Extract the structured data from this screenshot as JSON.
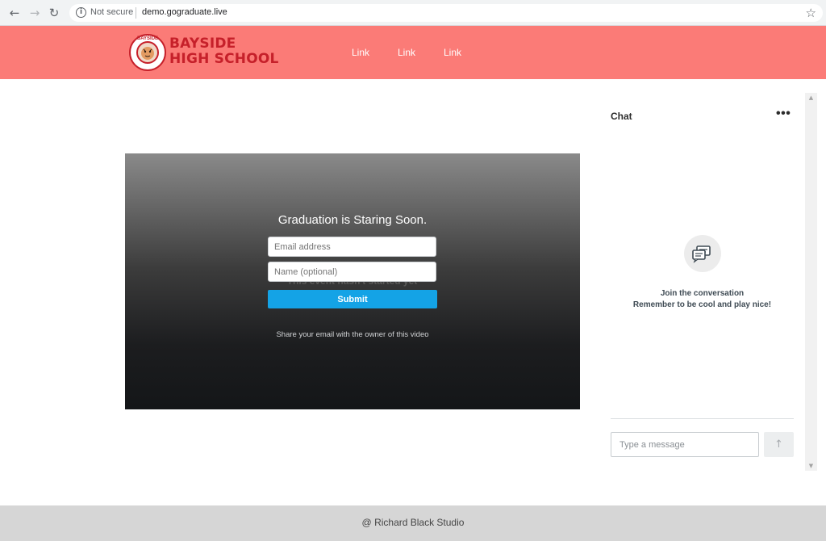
{
  "browser": {
    "back_icon": "arrow-left-icon",
    "forward_icon": "arrow-right-icon",
    "reload_icon": "reload-icon",
    "security_label": "Not secure",
    "url": "demo.gograduate.live",
    "bookmark_icon": "star-icon"
  },
  "header": {
    "logo_text": "BAYSIDE",
    "school_name_line1": "BAYSIDE",
    "school_name_line2": "HIGH SCHOOL",
    "nav_links": [
      "Link",
      "Link",
      "Link"
    ],
    "colors": {
      "background": "#fb7b77",
      "brand": "#c6202a"
    }
  },
  "video": {
    "title": "Graduation is Staring Soon.",
    "email_placeholder": "Email address",
    "name_placeholder": "Name (optional)",
    "ghost_text": "This event hasn't started yet",
    "submit_label": "Submit",
    "share_note": "Share your email with the owner of this video",
    "colors": {
      "submit": "#14a3e6"
    }
  },
  "chat": {
    "title": "Chat",
    "more_label": "•••",
    "empty_icon": "chat-bubbles-icon",
    "empty_line1": "Join the conversation",
    "empty_line2": "Remember to be cool and play nice!",
    "input_placeholder": "Type a message",
    "send_icon": "arrow-up-icon"
  },
  "footer": {
    "text": "@ Richard Black Studio"
  }
}
